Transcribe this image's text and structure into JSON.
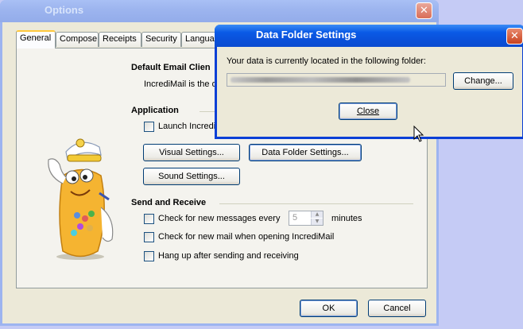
{
  "options_window": {
    "title": "Options",
    "tabs": [
      "General",
      "Compose",
      "Receipts",
      "Security",
      "Languag"
    ],
    "default_email_header": "Default Email Clien",
    "default_email_text": "IncrediMail is the de",
    "application_header": "Application",
    "launch_label": "Launch Incredi",
    "visual_settings_btn": "Visual Settings...",
    "data_folder_btn": "Data Folder Settings...",
    "sound_settings_btn": "Sound Settings...",
    "send_receive_header": "Send and Receive",
    "check_every_label": "Check for new messages every",
    "check_every_value": "5",
    "minutes_label": "minutes",
    "check_on_open_label": "Check for new mail when opening IncrediMail",
    "hang_up_label": "Hang up after sending and receiving",
    "ok_btn": "OK",
    "cancel_btn": "Cancel"
  },
  "data_folder_dialog": {
    "title": "Data Folder Settings",
    "message": "Your data is currently located in the following folder:",
    "change_btn": "Change...",
    "close_btn": "Close"
  },
  "colors": {
    "active_title": "#0a50d9",
    "inactive_title": "#9db5ef",
    "dialog_bg": "#ece9d8",
    "desktop": "#c5cbf5"
  }
}
